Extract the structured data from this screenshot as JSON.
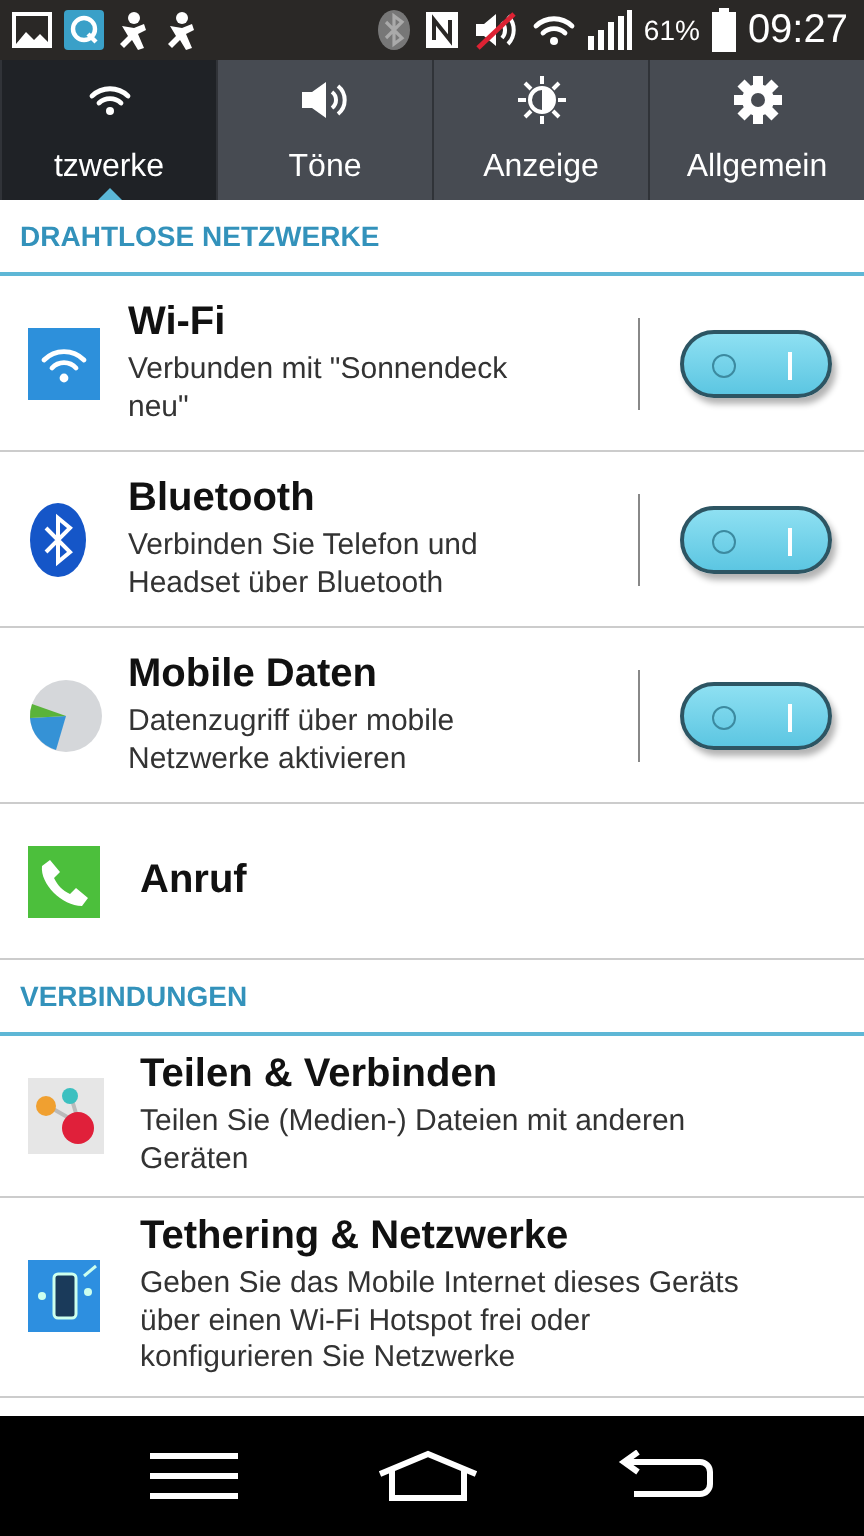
{
  "status_bar": {
    "battery": "61%",
    "time": "09:27"
  },
  "tabs": [
    {
      "label": "tzwerke",
      "selected": true
    },
    {
      "label": "Töne",
      "selected": false
    },
    {
      "label": "Anzeige",
      "selected": false
    },
    {
      "label": "Allgemein",
      "selected": false
    }
  ],
  "sections": [
    {
      "title": "DRAHTLOSE NETZWERKE",
      "items": [
        {
          "kind": "toggle",
          "title": "Wi-Fi",
          "subtitle": "Verbunden mit \"Sonnendeck neu\"",
          "on": true
        },
        {
          "kind": "toggle",
          "title": "Bluetooth",
          "subtitle": "Verbinden Sie Telefon und Headset über Bluetooth",
          "on": true
        },
        {
          "kind": "toggle",
          "title": "Mobile Daten",
          "subtitle": "Datenzugriff über mobile Netzwerke aktivieren",
          "on": true
        },
        {
          "kind": "link",
          "title": "Anruf"
        }
      ]
    },
    {
      "title": "VERBINDUNGEN",
      "items": [
        {
          "kind": "link",
          "title": "Teilen & Verbinden",
          "subtitle": "Teilen Sie (Medien-) Dateien mit anderen Geräten"
        },
        {
          "kind": "link",
          "title": "Tethering & Netzwerke",
          "subtitle": "Geben Sie das Mobile Internet dieses Geräts über einen Wi-Fi Hotspot frei oder konfigurieren Sie Netzwerke"
        }
      ]
    }
  ]
}
